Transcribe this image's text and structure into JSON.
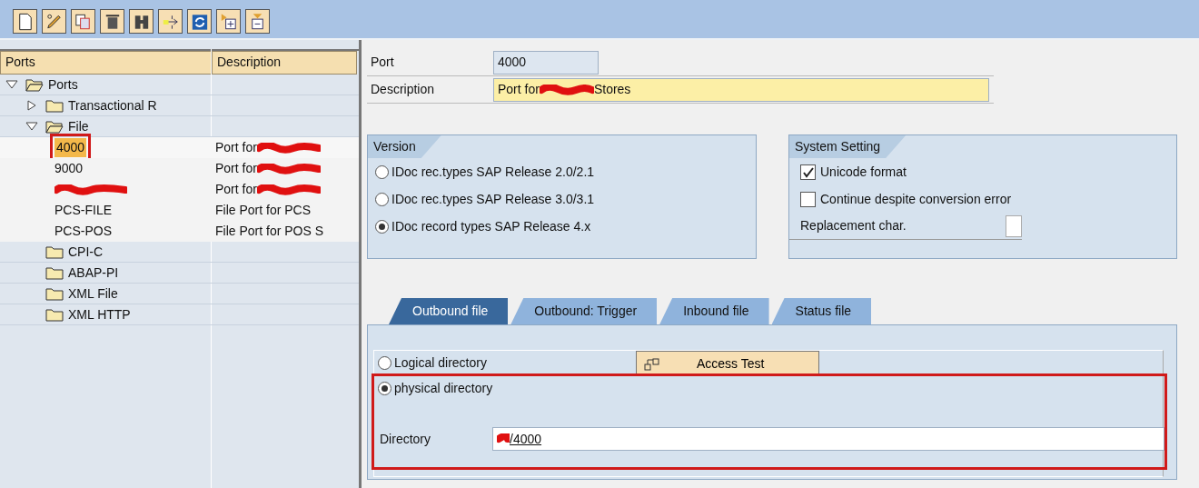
{
  "toolbar": [
    {
      "kind": "new"
    },
    {
      "kind": "edit"
    },
    {
      "kind": "copy"
    },
    {
      "kind": "delete"
    },
    {
      "kind": "find"
    },
    {
      "kind": "move"
    },
    {
      "kind": "refresh"
    },
    {
      "kind": "expand"
    },
    {
      "kind": "collapse"
    }
  ],
  "tree": {
    "columns": [
      "Ports",
      "Description"
    ],
    "nodes": [
      {
        "label": "Ports",
        "kind": "folder",
        "expanded": true,
        "children": [
          {
            "label": "Transactional R",
            "kind": "folder",
            "expanded": false
          },
          {
            "label": "File",
            "kind": "folder",
            "expanded": true,
            "children": [
              {
                "label": "4000",
                "kind": "port",
                "selected": true,
                "description": "Port for",
                "description_redacted": true
              },
              {
                "label": "9000",
                "kind": "port",
                "selected": false,
                "description": "Port for",
                "description_redacted": true
              },
              {
                "kind": "port",
                "selected": false,
                "label_redacted": true,
                "description": "Port for",
                "description_redacted": true
              },
              {
                "label": "PCS-FILE",
                "kind": "port",
                "selected": false,
                "description": "File Port for PCS"
              },
              {
                "label": "PCS-POS",
                "kind": "port",
                "selected": false,
                "description": "File Port for POS S"
              }
            ]
          },
          {
            "label": "CPI-C",
            "kind": "folder"
          },
          {
            "label": "ABAP-PI",
            "kind": "folder"
          },
          {
            "label": "XML File",
            "kind": "folder"
          },
          {
            "label": "XML HTTP",
            "kind": "folder"
          }
        ]
      }
    ]
  },
  "port": {
    "label": "Port",
    "value": "4000"
  },
  "description": {
    "label": "Description",
    "value_start": "Port for",
    "value_end": "Stores",
    "redacted": true
  },
  "version": {
    "title": "Version",
    "options": [
      {
        "label": "IDoc rec.types SAP Release 2.0/2.1",
        "selected": false
      },
      {
        "label": "IDoc rec.types SAP Release 3.0/3.1",
        "selected": false
      },
      {
        "label": "IDoc record types SAP Release 4.x",
        "selected": true
      }
    ]
  },
  "system_setting": {
    "title": "System Setting",
    "checkboxes": [
      {
        "label": "Unicode format",
        "checked": true
      },
      {
        "label": "Continue despite conversion error",
        "checked": false
      }
    ],
    "replacement_label": "Replacement char."
  },
  "tabs": [
    {
      "label": "Outbound file",
      "selected": true
    },
    {
      "label": "Outbound: Trigger",
      "selected": false
    },
    {
      "label": "Inbound file",
      "selected": false
    },
    {
      "label": "Status file",
      "selected": false
    }
  ],
  "outbound": {
    "directory_options": [
      {
        "label": "Logical directory",
        "selected": false
      },
      {
        "label": "physical directory",
        "selected": true
      }
    ],
    "access_test": "Access Test",
    "directory_label": "Directory",
    "directory_value": "/4000",
    "directory_redacted": true,
    "highlight": true
  }
}
